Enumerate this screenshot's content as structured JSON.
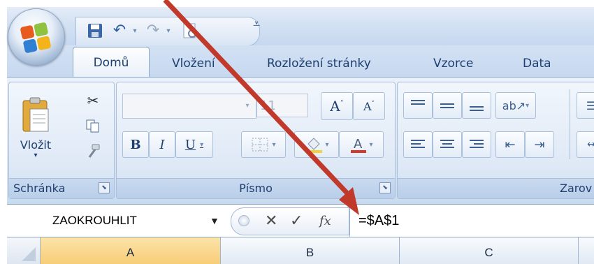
{
  "ribbon": {
    "tabs": [
      "Domů",
      "Vložení",
      "Rozložení stránky",
      "Vzorce",
      "Data"
    ],
    "groups": {
      "clipboard": {
        "label": "Schránka",
        "paste_label": "Vložit"
      },
      "font": {
        "label": "Písmo",
        "font_size": "11"
      },
      "alignment": {
        "label": "Zarov"
      }
    }
  },
  "formula_bar": {
    "name_box": "ZAOKROUHLIT",
    "cancel": "✕",
    "enter": "✓",
    "fx": "fx",
    "formula": "=$A$1"
  },
  "sheet": {
    "columns": [
      "A",
      "B",
      "C"
    ]
  },
  "colors": {
    "annotation_arrow": "#c0392b",
    "selected_column": "#f8cd77",
    "ribbon_text": "#1e3f6f"
  },
  "icons": [
    "office-logo-icon",
    "save-icon",
    "undo-icon",
    "redo-icon",
    "print-preview-icon",
    "customize-icon",
    "cut-icon",
    "copy-icon",
    "format-painter-icon",
    "paste-icon",
    "grow-font-icon",
    "shrink-font-icon",
    "bold-icon",
    "italic-icon",
    "underline-icon",
    "borders-icon",
    "fill-color-icon",
    "font-color-icon",
    "align-top-icon",
    "align-middle-icon",
    "align-bottom-icon",
    "orientation-icon",
    "align-left-icon",
    "align-center-icon",
    "align-right-icon",
    "decrease-indent-icon",
    "increase-indent-icon",
    "wrap-text-icon",
    "merge-icon",
    "cancel-icon",
    "enter-icon",
    "insert-function-icon"
  ]
}
